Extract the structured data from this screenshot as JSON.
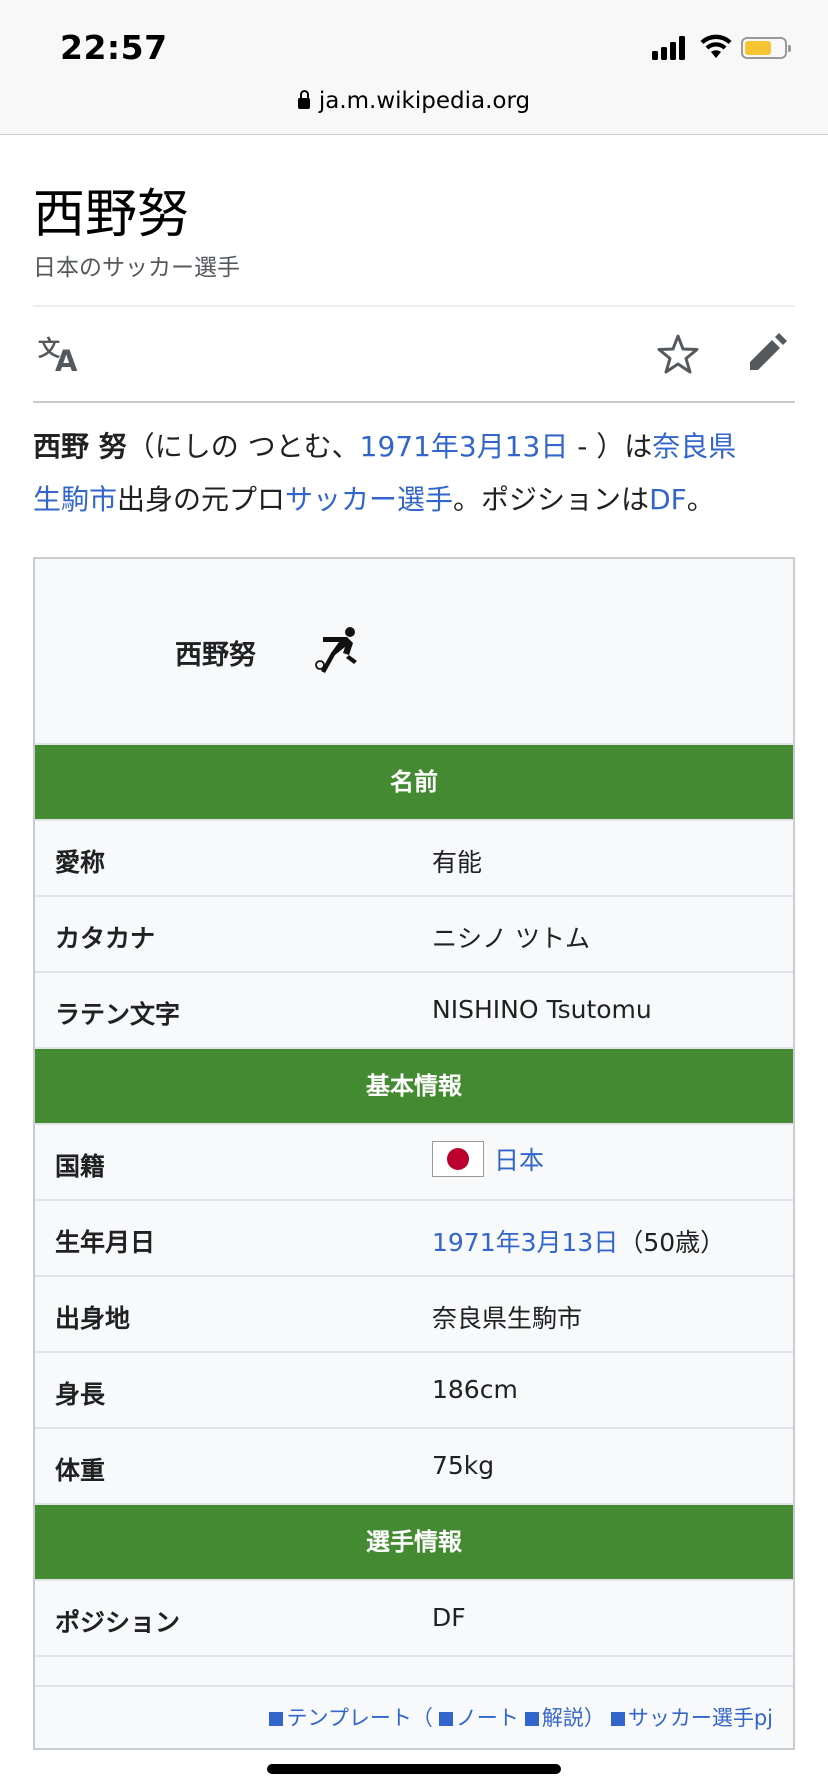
{
  "status_bar": {
    "time": "22:57",
    "url": "ja.m.wikipedia.org",
    "battery_color": "#f5c430"
  },
  "header": {
    "title": "西野努",
    "subtitle": "日本のサッカー選手"
  },
  "toolbar": {
    "translate_icon": "translate-icon",
    "watch_icon": "star-icon",
    "edit_icon": "pencil-icon"
  },
  "lead": {
    "bold_name": "西野 努",
    "reading": "（にしの つとむ、",
    "birth_link": "1971年3月13日",
    "dash": " - ）は",
    "place_link_1": "奈良県",
    "place_link_2": "生駒市",
    "text_mid": "出身の元プロ",
    "sport_link": "サッカー選手",
    "text_end_1": "。ポジションは",
    "position_link": "DF",
    "text_end_2": "。"
  },
  "infobox": {
    "name": "西野努",
    "icon": "soccer-player-icon",
    "header_color": "#448a32",
    "sections": {
      "names": "名前",
      "basic": "基本情報",
      "player": "選手情報"
    },
    "rows_names": [
      {
        "key": "愛称",
        "value": "有能"
      },
      {
        "key": "カタカナ",
        "value": "ニシノ ツトム"
      },
      {
        "key": "ラテン文字",
        "value": "NISHINO Tsutomu"
      }
    ],
    "rows_basic": {
      "nationality_key": "国籍",
      "nationality_value": "日本",
      "birth_key": "生年月日",
      "birth_value": "1971年3月13日",
      "age_value": "（50歳）",
      "hometown_key": "出身地",
      "hometown_value": "奈良県生駒市",
      "height_key": "身長",
      "height_value": "186cm",
      "weight_key": "体重",
      "weight_value": "75kg"
    },
    "rows_player": {
      "position_key": "ポジション",
      "position_value": "DF"
    },
    "footer": {
      "template": "テンプレート",
      "open_paren": "（",
      "note": "ノート",
      "explain": "解説",
      "close_paren": "）",
      "project": "サッカー選手pj"
    }
  }
}
